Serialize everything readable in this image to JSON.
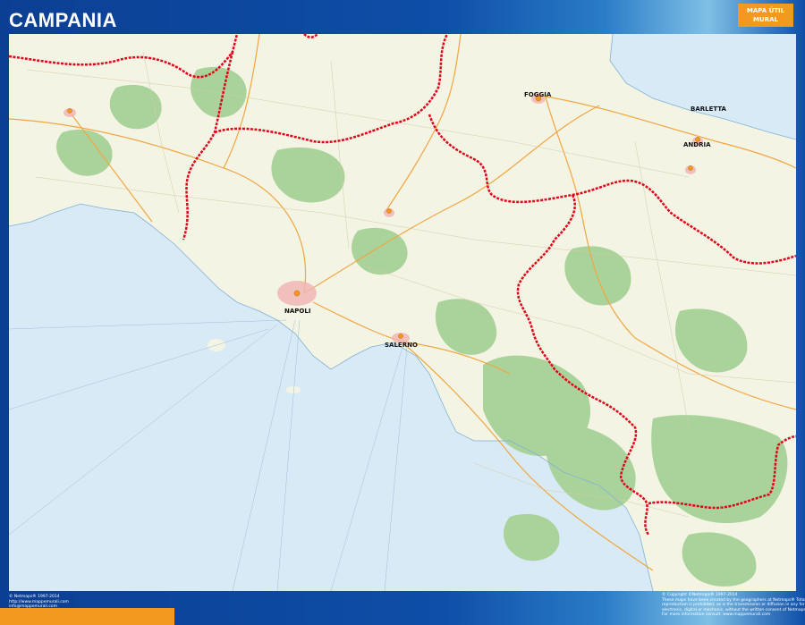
{
  "header": {
    "title": "CAMPANIA",
    "badge_line1": "MAPA ÚTIL",
    "badge_line2": "MURAL"
  },
  "map": {
    "labels": {
      "foggia": "FOGGIA",
      "barletta": "BARLETTA",
      "andria": "ANDRIA",
      "napoli": "NAPOLI",
      "salerno": "SALERNO"
    },
    "colors": {
      "sea": "#d8eaf6",
      "land": "#f3f4e4",
      "forest": "#a9d39a",
      "border": "#e2001a",
      "road": "#f2a541"
    }
  },
  "footer": {
    "left": [
      "© Netmaps® 1997-2014",
      "http://www.mappemurali.com",
      "info@mappemurali.com"
    ],
    "right": [
      "© Copyright ©Netmaps® 1997-2014",
      "These maps have been created by the geographers at Netmaps® Total or partial",
      "reproduction is prohibited, as is the transmission or diffusion in any form, be that",
      "electronic, digital or mechanic, without the written consent of Netmaps®",
      "For more information consult: www.mappemurali.com"
    ]
  }
}
